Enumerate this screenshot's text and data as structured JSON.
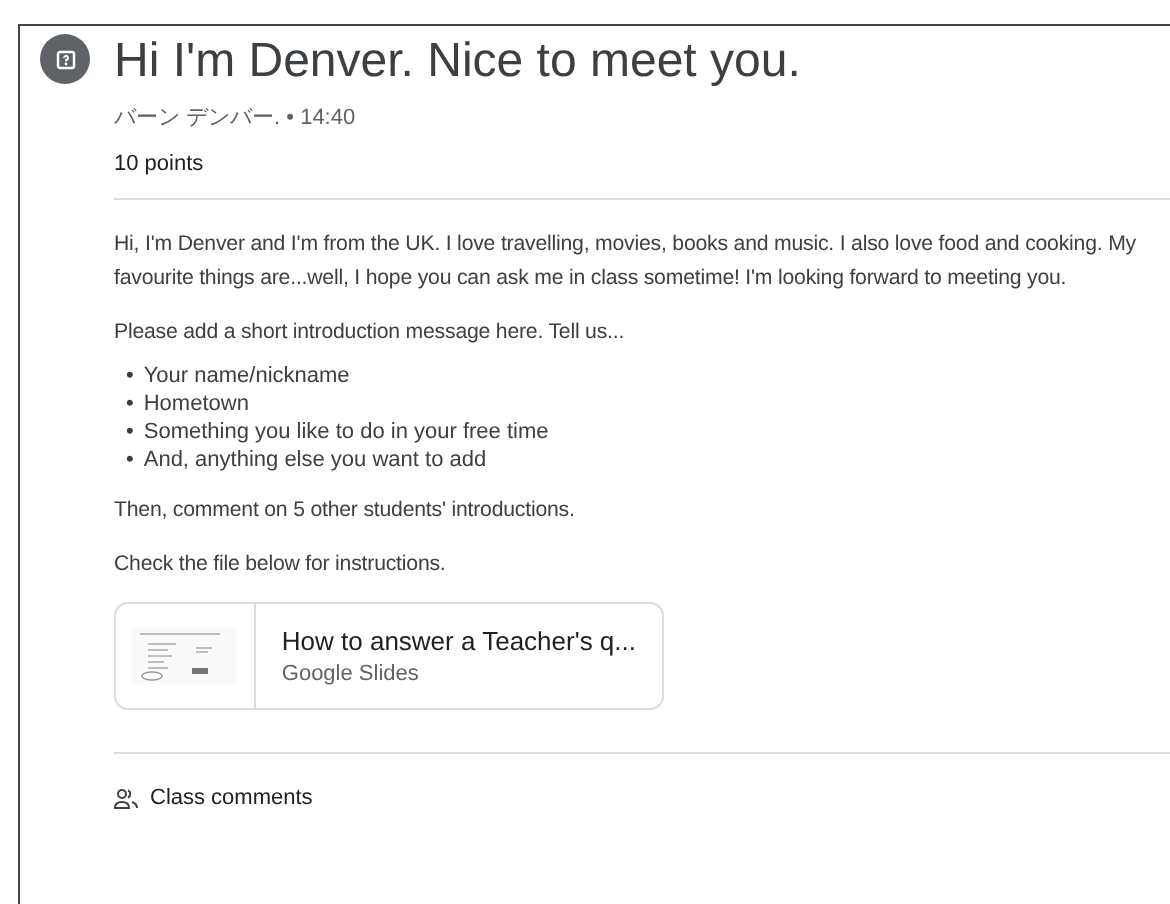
{
  "title": "Hi I'm Denver. Nice to meet you.",
  "meta": "バーン デンバー. • 14:40",
  "points": "10 points",
  "intro": "Hi, I'm Denver and I'm from the UK. I love travelling, movies, books and music. I also love food and cooking. My favourite things are...well, I hope you can ask me in class sometime! I'm looking forward to meeting you.",
  "prompt": "Please add a short introduction message here. Tell us...",
  "bullets": [
    {
      "marker": "•",
      "text": "Your name/nickname"
    },
    {
      "marker": "•",
      "text": "Hometown"
    },
    {
      "marker": "•",
      "text": "Something you like to do in your free time"
    },
    {
      "marker": "•",
      "text": "And, anything else you want to add"
    }
  ],
  "then": "Then, comment on 5 other students' introductions.",
  "check": "Check the file below for instructions.",
  "attachment": {
    "title": "How to answer a Teacher's q...",
    "type": "Google Slides"
  },
  "comments": "Class comments"
}
